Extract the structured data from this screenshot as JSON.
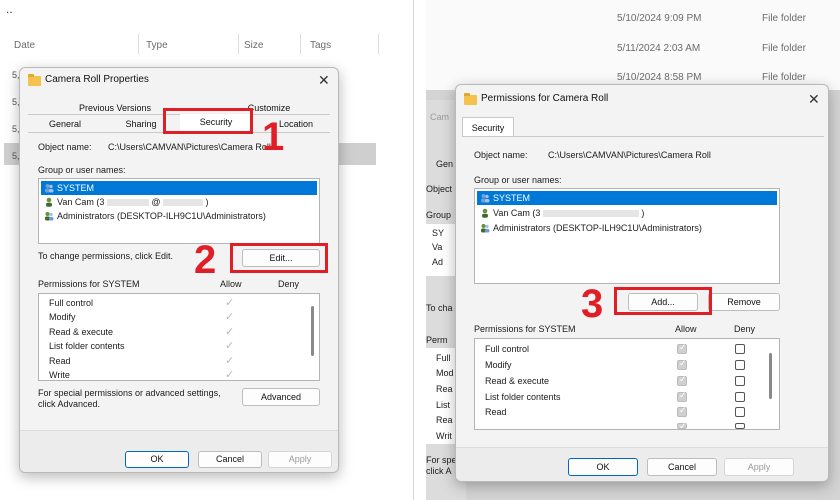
{
  "left": {
    "top_fragment": "..",
    "explorer_columns": [
      "Date",
      "Type",
      "Size",
      "Tags"
    ],
    "row_fragments": [
      "5,",
      "5,",
      "5,",
      "5,"
    ],
    "dialog": {
      "title": "Camera Roll Properties",
      "tabs_row1": [
        "Previous Versions",
        "Customize"
      ],
      "tabs_row2": [
        "General",
        "Sharing",
        "Security",
        "Location"
      ],
      "object_name_label": "Object name:",
      "object_name_value": "C:\\Users\\CAMVAN\\Pictures\\Camera Roll",
      "group_label": "Group or user names:",
      "users": [
        "SYSTEM",
        "Van Cam (3",
        "@ ",
        ")",
        "Administrators (DESKTOP-ILH9C1U\\Administrators)"
      ],
      "change_text": "To change permissions, click Edit.",
      "edit_button": "Edit...",
      "perm_header": "Permissions for SYSTEM",
      "allow": "Allow",
      "deny": "Deny",
      "permissions": [
        "Full control",
        "Modify",
        "Read & execute",
        "List folder contents",
        "Read",
        "Write"
      ],
      "special_text_1": "For special permissions or advanced settings,",
      "special_text_2": "click Advanced.",
      "advanced_button": "Advanced",
      "ok": "OK",
      "cancel": "Cancel",
      "apply": "Apply"
    },
    "step1": "1",
    "step2": "2"
  },
  "right": {
    "explorer_rows": [
      {
        "date": "5/10/2024 9:09 PM",
        "type": "File folder"
      },
      {
        "date": "5/11/2024 2:03 AM",
        "type": "File folder"
      },
      {
        "date": "5/10/2024 8:58 PM",
        "type": "File folder"
      }
    ],
    "behind_fragments": [
      "Cam",
      "Gen",
      "Object",
      "Group",
      "SY",
      "Va",
      "Ad",
      "To cha",
      "Perm",
      "Full",
      "Mod",
      "Rea",
      "List",
      "Rea",
      "Writ",
      "For spe",
      "click A"
    ],
    "dialog": {
      "title": "Permissions for Camera Roll",
      "tab": "Security",
      "object_name_label": "Object name:",
      "object_name_value": "C:\\Users\\CAMVAN\\Pictures\\Camera Roll",
      "group_label": "Group or user names:",
      "users": [
        "SYSTEM",
        "Van Cam (3",
        ")",
        "Administrators (DESKTOP-ILH9C1U\\Administrators)"
      ],
      "add_button": "Add...",
      "remove_button": "Remove",
      "perm_header": "Permissions for SYSTEM",
      "allow": "Allow",
      "deny": "Deny",
      "permissions": [
        "Full control",
        "Modify",
        "Read & execute",
        "List folder contents",
        "Read"
      ],
      "ok": "OK",
      "cancel": "Cancel",
      "apply": "Apply"
    },
    "step3": "3"
  },
  "colors": {
    "highlight": "#e01e25",
    "selection": "#0078d7",
    "folder": "#f4c24d"
  }
}
